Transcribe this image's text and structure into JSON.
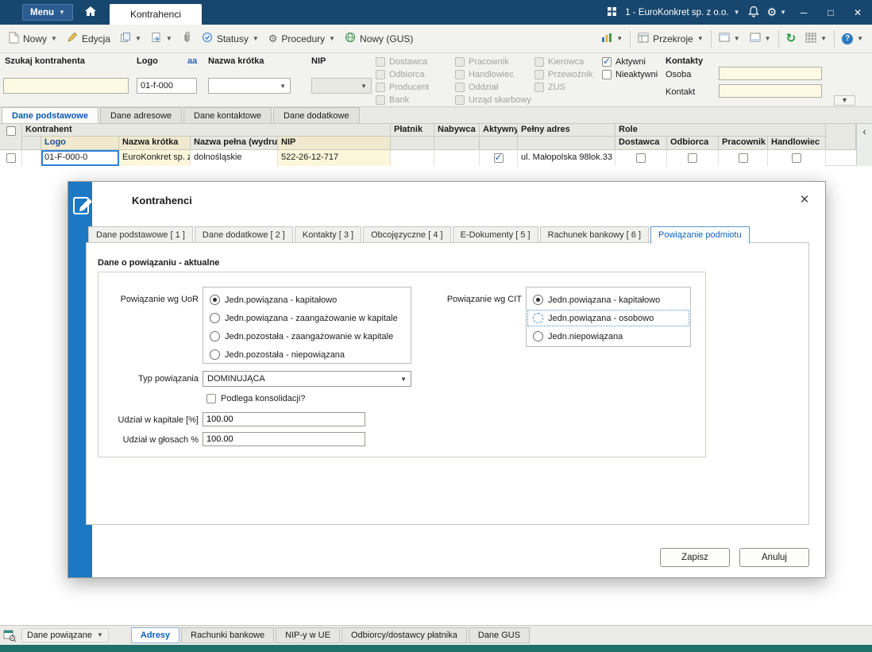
{
  "titlebar": {
    "menu": "Menu",
    "active_tab": "Kontrahenci",
    "company": "1 - EuroKonkret sp. z o.o."
  },
  "toolbar": {
    "nowy": "Nowy",
    "edycja": "Edycja",
    "statusy": "Statusy",
    "procedury": "Procedury",
    "nowy_gus": "Nowy (GUS)",
    "przekroje": "Przekroje"
  },
  "filter": {
    "szukaj_label": "Szukaj kontrahenta",
    "logo_label": "Logo",
    "aa": "aa",
    "logo_value": "01-f-000",
    "nazwa_krotka_label": "Nazwa krótka",
    "nip_label": "NIP",
    "col1": [
      "Dostawca",
      "Odbiorca",
      "Producent",
      "Bank"
    ],
    "col2": [
      "Pracownik",
      "Handlowiec",
      "Oddział",
      "Urząd skarbowy"
    ],
    "col3": [
      "Kierowca",
      "Przewoźnik",
      "ZUS"
    ],
    "aktywni": "Aktywni",
    "nieaktywni": "Nieaktywni",
    "kontakty_label": "Kontakty",
    "osoba_label": "Osoba",
    "kontakt_label": "Kontakt"
  },
  "view_tabs": [
    "Dane podstawowe",
    "Dane adresowe",
    "Dane kontaktowe",
    "Dane dodatkowe"
  ],
  "grid": {
    "group_kontrahent": "Kontrahent",
    "group_role": "Role",
    "col_logo": "Logo",
    "col_nazwa_krotka": "Nazwa krótka",
    "col_nazwa_pelna": "Nazwa pełna (wydruki)",
    "col_nip": "NIP",
    "col_platnik": "Płatnik",
    "col_nabywca": "Nabywca",
    "col_aktywny": "Aktywny",
    "col_pelny_adres": "Pełny adres",
    "col_dostawca": "Dostawca",
    "col_odbiorca": "Odbiorca",
    "col_pracownik": "Pracownik",
    "col_handlowiec": "Handlowiec",
    "row": {
      "logo": "01-F-000-0",
      "nazwa_krotka": "EuroKonkret sp. z o.o.",
      "nazwa_pelna": "dolnośląskie",
      "nip": "522-26-12-717",
      "pelny_adres": "ul. Małopolska 98lok.33"
    }
  },
  "dialog": {
    "title": "Kontrahenci",
    "tabs": [
      "Dane podstawowe [ 1 ]",
      "Dane dodatkowe [ 2 ]",
      "Kontakty [ 3 ]",
      "Obcojęzyczne [ 4 ]",
      "E-Dokumenty [ 5 ]",
      "Rachunek bankowy [ 6 ]",
      "Powiązanie podmiotu"
    ],
    "section_title": "Dane o powiązaniu - aktualne",
    "uor_label": "Powiązanie wg UoR",
    "uor_options": [
      "Jedn.powiązana - kapitałowo",
      "Jedn.powiązana - zaangażowanie w kapitale",
      "Jedn.pozostała - zaangażowanie w kapitale",
      "Jedn.pozostała - niepowiązana"
    ],
    "cit_label": "Powiązanie wg CIT",
    "cit_options": [
      "Jedn.powiązana - kapitałowo",
      "Jedn.powiązana - osobowo",
      "Jedn.niepowiązana"
    ],
    "typ_label": "Typ powiązania",
    "typ_value": "DOMINUJĄCA",
    "konsolidacja_label": "Podlega konsolidacji?",
    "kapital_label": "Udział w kapitale [%]",
    "kapital_value": "100.00",
    "glosy_label": "Udział w głosach %",
    "glosy_value": "100.00",
    "save": "Zapisz",
    "cancel": "Anuluj"
  },
  "bottom": {
    "dane_powiazane": "Dane powiązane",
    "tabs": [
      "Adresy",
      "Rachunki bankowe",
      "NIP-y w UE",
      "Odbiorcy/dostawcy płatnika",
      "Dane GUS"
    ]
  },
  "colors": {
    "titlebar": "#17466e",
    "accent_blue": "#0a62c0",
    "strip_blue": "#1d78c4",
    "teal": "#20706a"
  }
}
